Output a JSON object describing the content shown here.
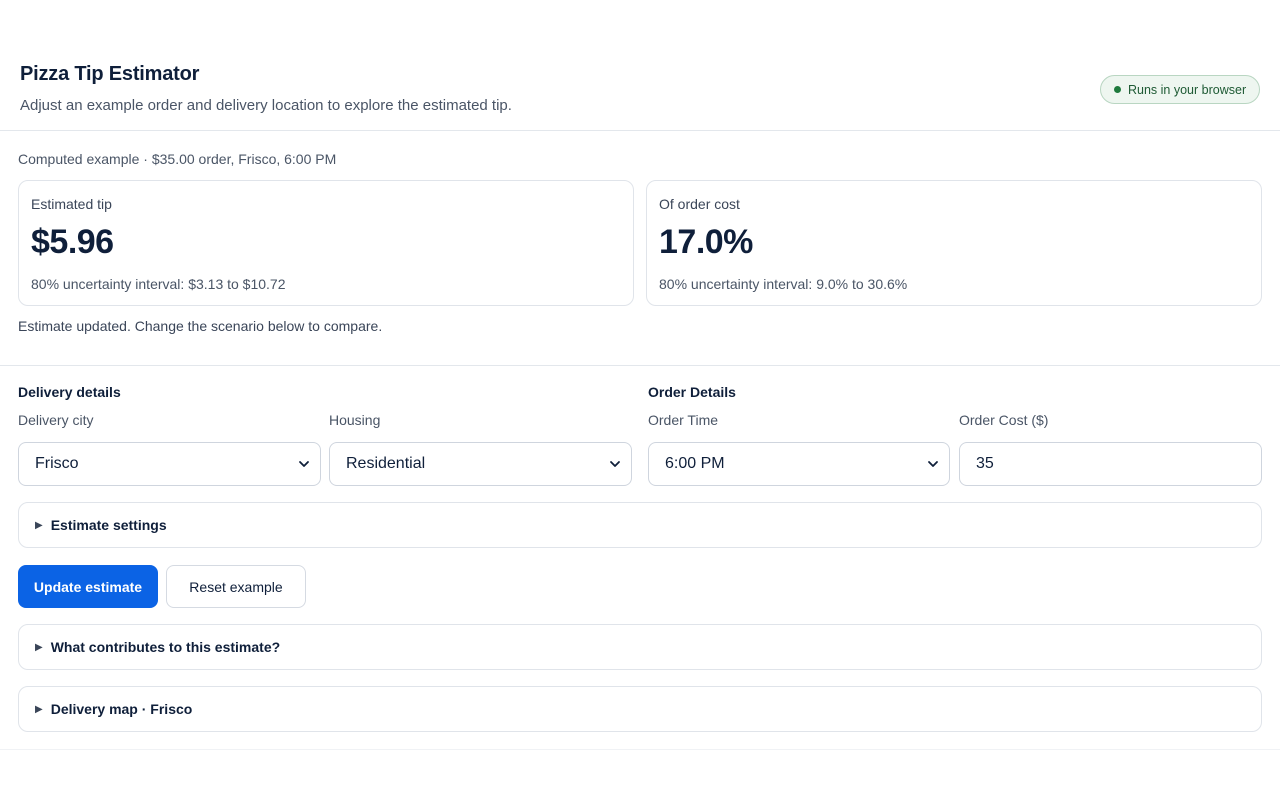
{
  "header": {
    "title": "Pizza Tip Estimator",
    "subtitle": "Adjust an example order and delivery location to explore the estimated tip.",
    "badge": "Runs in your browser"
  },
  "summary": {
    "computed_label": "Computed example · $35.00 order, Frisco, 6:00 PM",
    "tip": {
      "label": "Estimated tip",
      "value": "$5.96",
      "interval": "80% uncertainty interval: $3.13 to $10.72"
    },
    "percent": {
      "label": "Of order cost",
      "value": "17.0%",
      "interval": "80% uncertainty interval: 9.0% to 30.6%"
    },
    "status": "Estimate updated. Change the scenario below to compare."
  },
  "delivery": {
    "title": "Delivery details",
    "city_label": "Delivery city",
    "city_value": "Frisco",
    "housing_label": "Housing",
    "housing_value": "Residential"
  },
  "order": {
    "title": "Order Details",
    "time_label": "Order Time",
    "time_value": "6:00 PM",
    "cost_label": "Order Cost ($)",
    "cost_value": "35"
  },
  "sections": {
    "settings": "Estimate settings",
    "contributions": "What contributes to this estimate?",
    "map": "Delivery map · Frisco"
  },
  "actions": {
    "update": "Update estimate",
    "reset": "Reset example"
  },
  "colors": {
    "primary": "#0b63e5",
    "badge_green": "#1f7a3d"
  }
}
